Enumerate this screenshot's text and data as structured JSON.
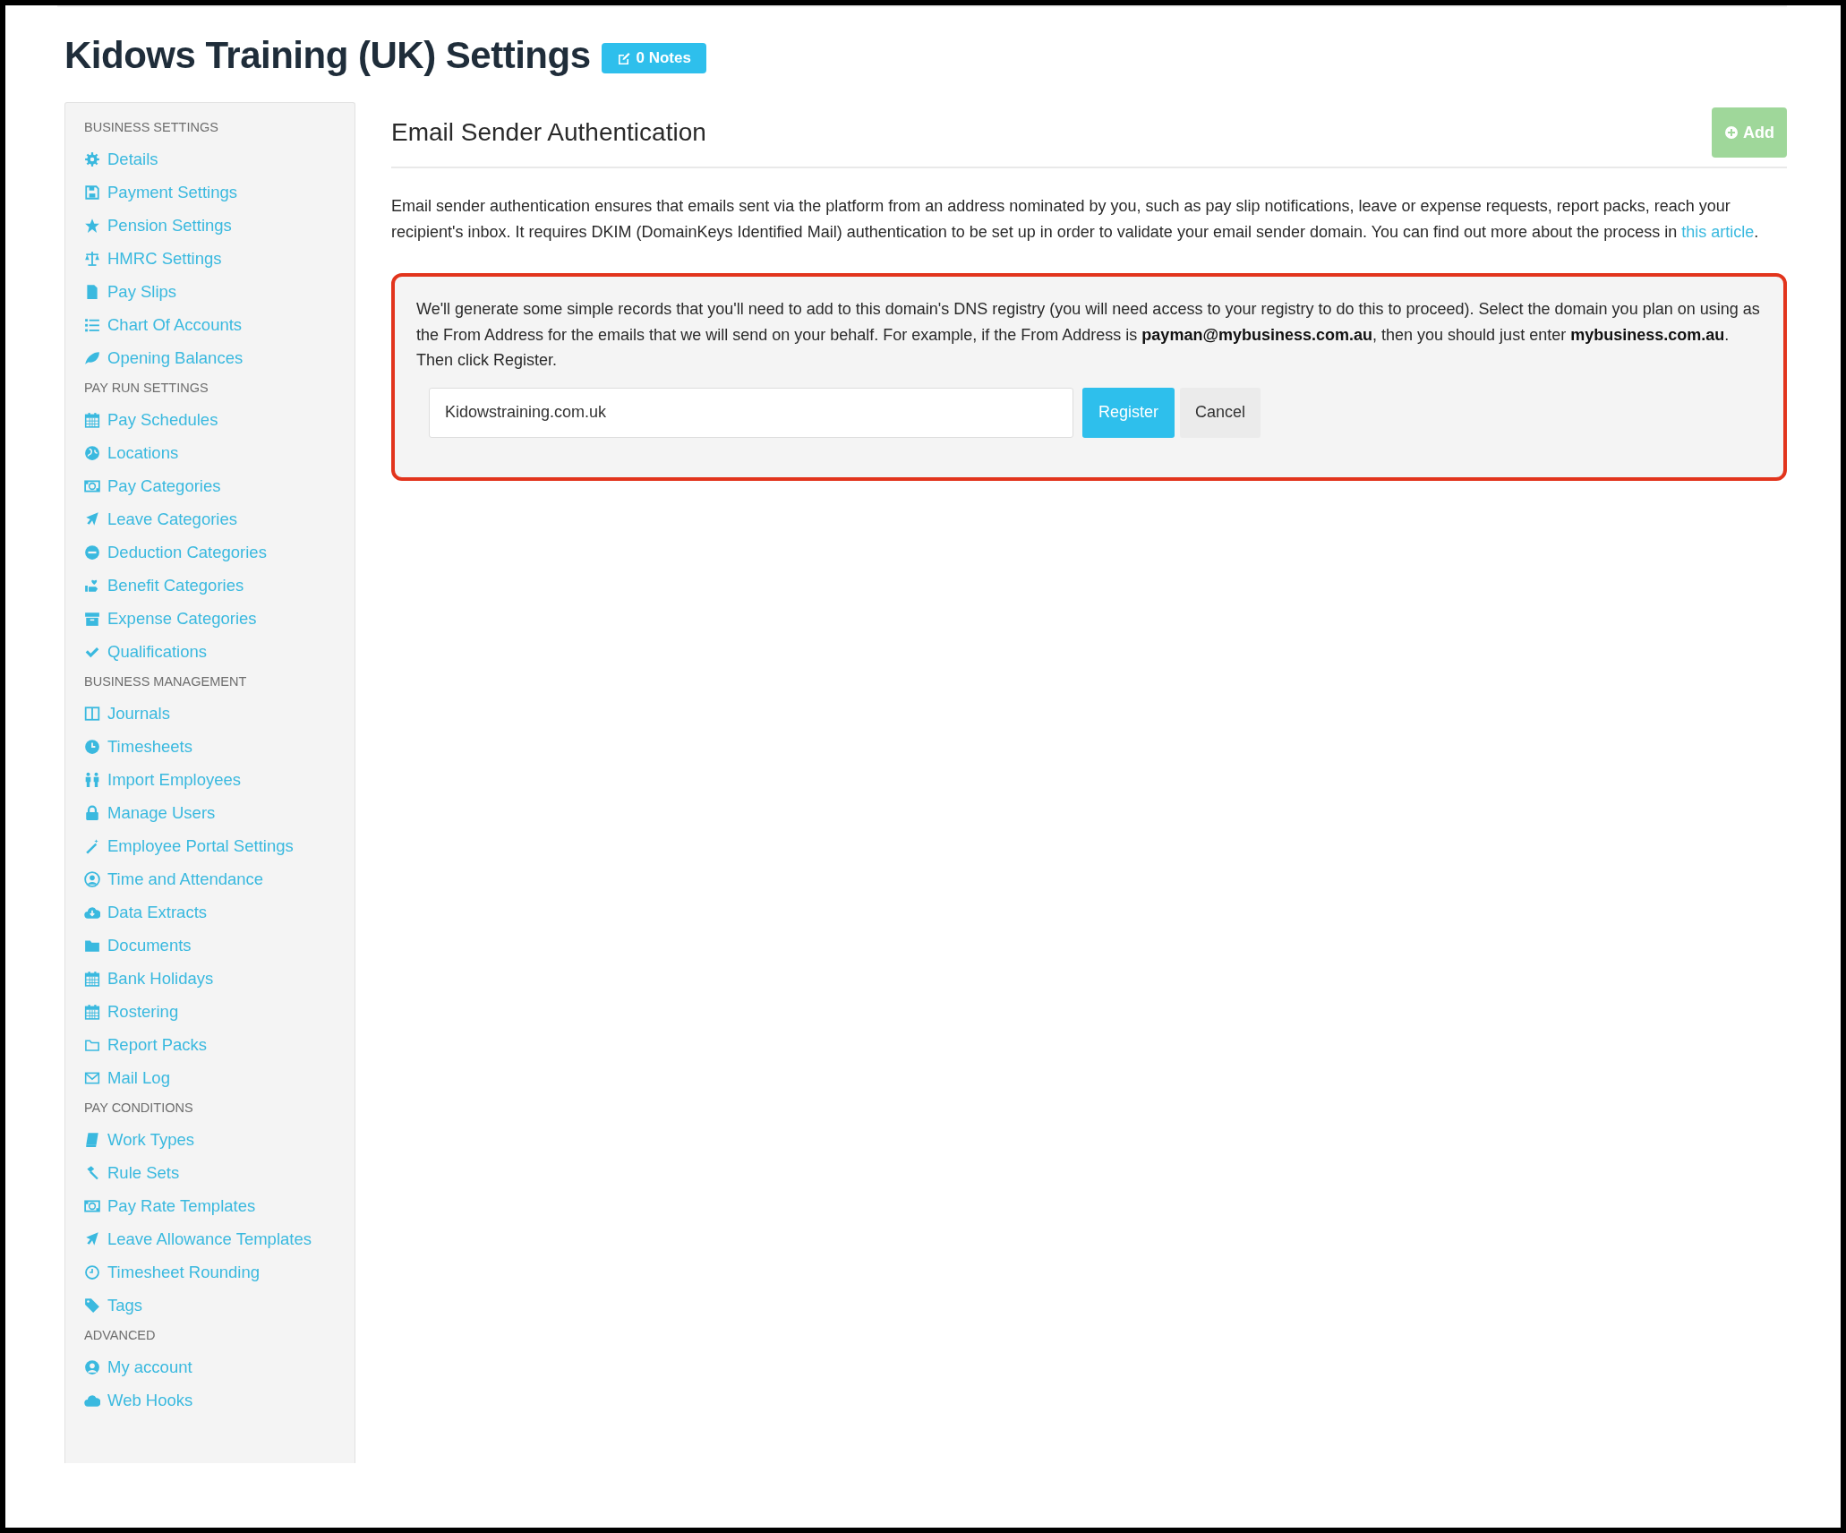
{
  "page": {
    "title": "Kidows Training (UK) Settings",
    "notes_button": "0 Notes"
  },
  "sidebar": {
    "sections": [
      {
        "heading": "BUSINESS SETTINGS",
        "items": [
          {
            "label": "Details"
          },
          {
            "label": "Payment Settings"
          },
          {
            "label": "Pension Settings"
          },
          {
            "label": "HMRC Settings"
          },
          {
            "label": "Pay Slips"
          },
          {
            "label": "Chart Of Accounts"
          },
          {
            "label": "Opening Balances"
          }
        ]
      },
      {
        "heading": "PAY RUN SETTINGS",
        "items": [
          {
            "label": "Pay Schedules"
          },
          {
            "label": "Locations"
          },
          {
            "label": "Pay Categories"
          },
          {
            "label": "Leave Categories"
          },
          {
            "label": "Deduction Categories"
          },
          {
            "label": "Benefit Categories"
          },
          {
            "label": "Expense Categories"
          },
          {
            "label": "Qualifications"
          }
        ]
      },
      {
        "heading": "BUSINESS MANAGEMENT",
        "items": [
          {
            "label": "Journals"
          },
          {
            "label": "Timesheets"
          },
          {
            "label": "Import Employees"
          },
          {
            "label": "Manage Users"
          },
          {
            "label": "Employee Portal Settings"
          },
          {
            "label": "Time and Attendance"
          },
          {
            "label": "Data Extracts"
          },
          {
            "label": "Documents"
          },
          {
            "label": "Bank Holidays"
          },
          {
            "label": "Rostering"
          },
          {
            "label": "Report Packs"
          },
          {
            "label": "Mail Log"
          }
        ]
      },
      {
        "heading": "PAY CONDITIONS",
        "items": [
          {
            "label": "Work Types"
          },
          {
            "label": "Rule Sets"
          },
          {
            "label": "Pay Rate Templates"
          },
          {
            "label": "Leave Allowance Templates"
          },
          {
            "label": "Timesheet Rounding"
          },
          {
            "label": "Tags"
          }
        ]
      },
      {
        "heading": "ADVANCED",
        "items": [
          {
            "label": "My account"
          },
          {
            "label": "Web Hooks"
          }
        ]
      }
    ]
  },
  "main": {
    "heading": "Email Sender Authentication",
    "add_button": {
      "label": "Add",
      "disabled": true
    },
    "intro": "Email sender authentication ensures that emails sent via the platform from an address nominated by you, such as pay slip notifications, leave or expense requests, report packs, reach your recipient's inbox. It requires DKIM (DomainKeys Identified Mail) authentication to be set up in order to validate your email sender domain. You can find out more about the process in ",
    "intro_link": "this article",
    "intro_end": ".",
    "panel": {
      "text": "We'll generate some simple records that you'll need to add to this domain's DNS registry (you will need access to your registry to do this to proceed). Select the domain you plan on using as the From Address for the emails that we will send on your behalf. For example, if the From Address is **payman@mybusiness.com.au**, then you should just enter **mybusiness.com.au**. Then click Register.",
      "domain_value": "Kidowstraining.com.uk",
      "register_button": "Register",
      "cancel_button": "Cancel"
    }
  }
}
